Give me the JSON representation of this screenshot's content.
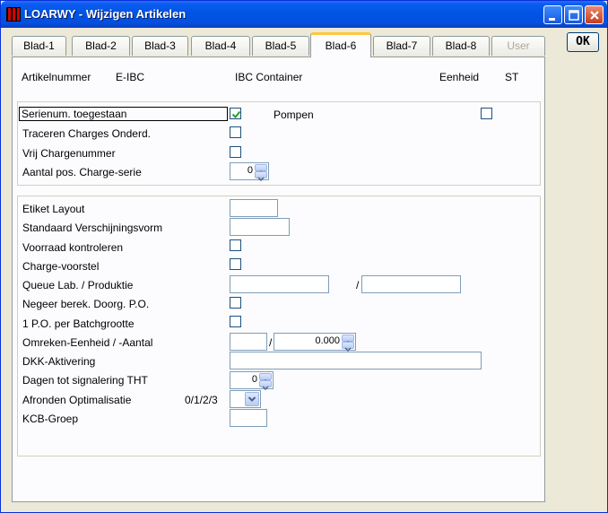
{
  "window": {
    "title": "LOARWY - Wijzigen Artikelen"
  },
  "toolbar": {
    "ok_label": "OK"
  },
  "tabs": [
    {
      "label": "Blad-1",
      "active": false,
      "disabled": false
    },
    {
      "label": "Blad-2",
      "active": false,
      "disabled": false
    },
    {
      "label": "Blad-3",
      "active": false,
      "disabled": false
    },
    {
      "label": "Blad-4",
      "active": false,
      "disabled": false
    },
    {
      "label": "Blad-5",
      "active": false,
      "disabled": false
    },
    {
      "label": "Blad-6",
      "active": true,
      "disabled": false
    },
    {
      "label": "Blad-7",
      "active": false,
      "disabled": false
    },
    {
      "label": "Blad-8",
      "active": false,
      "disabled": false
    },
    {
      "label": "User",
      "active": false,
      "disabled": true
    }
  ],
  "header": {
    "artikelnummer_label": "Artikelnummer",
    "artikelnummer_value": "E-IBC",
    "description": "IBC Container",
    "eenheid_label": "Eenheid",
    "eenheid_value": "ST"
  },
  "group1": {
    "serienum_label": "Serienum. toegestaan",
    "serienum_checked": true,
    "pompen_label": "Pompen",
    "pompen_checked": false,
    "traceren_label": "Traceren Charges Onderd.",
    "traceren_checked": false,
    "vrij_label": "Vrij Chargenummer",
    "vrij_checked": false,
    "aantal_label": "Aantal pos. Charge-serie",
    "aantal_value": "0"
  },
  "group2": {
    "etiket_label": "Etiket Layout",
    "etiket_value": "",
    "standaard_label": "Standaard Verschijningsvorm",
    "standaard_value": "",
    "voorraad_label": "Voorraad kontroleren",
    "voorraad_checked": false,
    "charge_label": "Charge-voorstel",
    "charge_checked": false,
    "queue_label": "Queue Lab. / Produktie",
    "queue_lab_value": "",
    "queue_separator": "/",
    "queue_prod_value": "",
    "negeer_label": "Negeer berek. Doorg. P.O.",
    "negeer_checked": false,
    "po_label": "1 P.O. per Batchgrootte",
    "po_checked": false,
    "omreken_label": "Omreken-Eenheid / -Aantal",
    "omreken_eenheid_value": "",
    "omreken_separator": "/",
    "omreken_aantal_value": "0.000",
    "dkk_label": "DKK-Aktivering",
    "dkk_value": "",
    "dagen_label": "Dagen tot signalering THT",
    "dagen_value": "0",
    "afronden_label": "Afronden Optimalisatie",
    "afronden_hint": "0/1/2/3",
    "afronden_value": "",
    "kcb_label": "KCB-Groep",
    "kcb_value": ""
  },
  "colors": {
    "titlebar": "#0054e3",
    "window_bg": "#ece9d8",
    "panel_bg": "#fcfcfe",
    "tab_highlight": "#ffc83c"
  }
}
